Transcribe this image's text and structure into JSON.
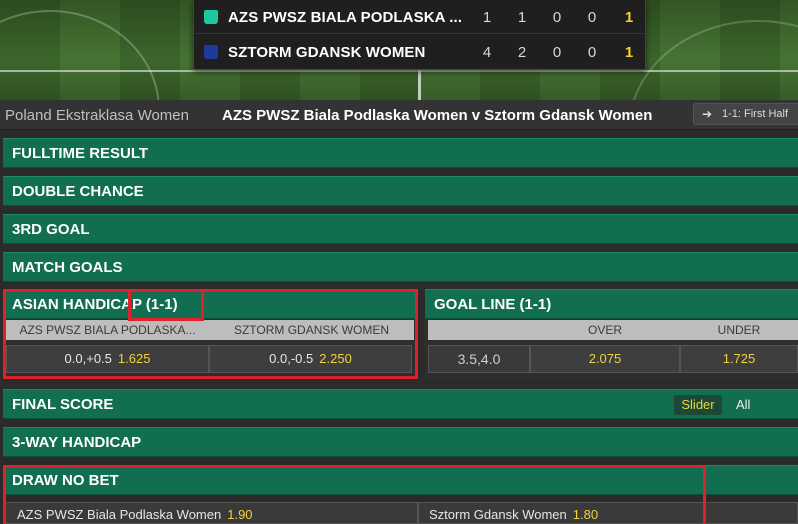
{
  "scoreboard": {
    "team1": {
      "name": "AZS PWSZ BIALA PODLASKA ...",
      "cols": [
        "1",
        "1",
        "0",
        "0",
        "1"
      ]
    },
    "team2": {
      "name": "SZTORM GDANSK WOMEN",
      "cols": [
        "4",
        "2",
        "0",
        "0",
        "1"
      ]
    }
  },
  "event": {
    "league": "Poland Ekstraklasa Women",
    "match": "AZS PWSZ Biala Podlaska Women v Sztorm Gdansk Women",
    "chip": "1-1: First Half"
  },
  "markets": {
    "fulltime": "FULLTIME RESULT",
    "double_chance": "DOUBLE CHANCE",
    "third_goal": "3RD GOAL",
    "match_goals": "MATCH GOALS",
    "final_score": "FINAL SCORE",
    "three_way": "3-WAY HANDICAP",
    "draw_no_bet": "DRAW NO BET"
  },
  "asian_handicap": {
    "title": "ASIAN HANDICAP (1-1)",
    "col1": "AZS PWSZ BIALA PODLASKA...",
    "col2": "SZTORM GDANSK WOMEN",
    "home": {
      "line": "0.0,+0.5",
      "price": "1.625"
    },
    "away": {
      "line": "0.0,-0.5",
      "price": "2.250"
    }
  },
  "goal_line": {
    "title": "GOAL LINE (1-1)",
    "over_label": "OVER",
    "under_label": "UNDER",
    "line": "3.5,4.0",
    "over": "2.075",
    "under": "1.725"
  },
  "final_score_toggle": {
    "slider": "Slider",
    "all": "All"
  },
  "dnb": {
    "home": {
      "name": "AZS PWSZ Biala Podlaska Women",
      "price": "1.90"
    },
    "away": {
      "name": "Sztorm Gdansk Women",
      "price": "1.80"
    }
  },
  "colors": {
    "market_green": "#126e51",
    "price_yellow": "#f2d23a",
    "highlight_red": "#e0202a"
  }
}
